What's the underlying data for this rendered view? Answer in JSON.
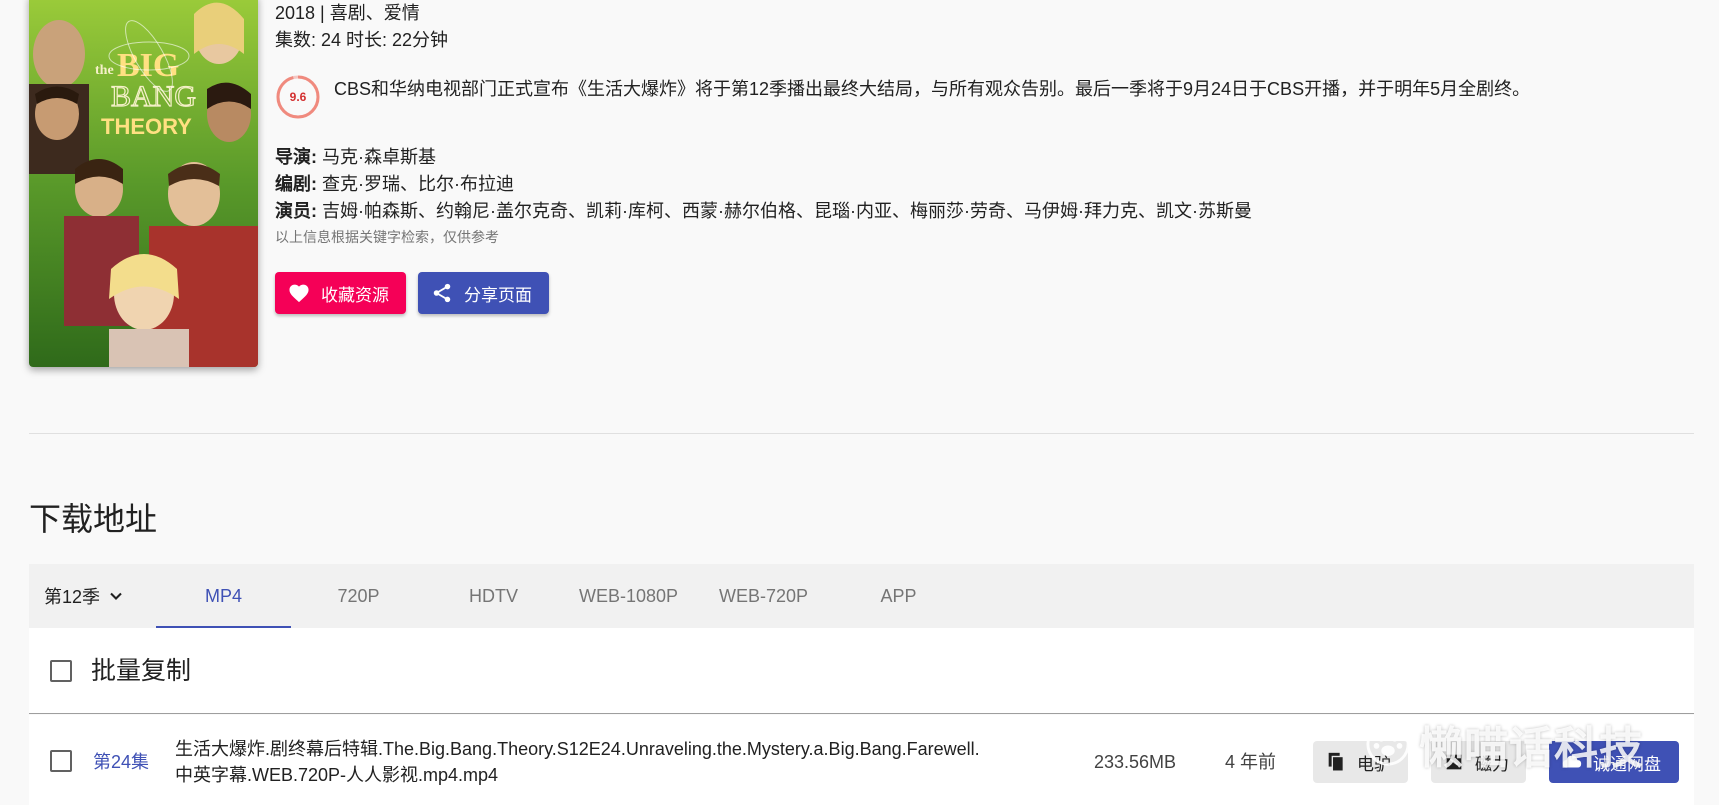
{
  "poster": {
    "title_line1": "the",
    "title_line2": "BIG",
    "title_line3": "BANG",
    "title_line4": "THEORY"
  },
  "info": {
    "year_genre": "2018 | 喜剧、爱情",
    "episodes_duration": "集数: 24 时长: 22分钟",
    "score": "9.6",
    "description": "CBS和华纳电视部门正式宣布《生活大爆炸》将于第12季播出最终大结局，与所有观众告别。最后一季将于9月24日于CBS开播，并于明年5月全剧终。",
    "director_label": "导演:",
    "director": "马克·森卓斯基",
    "writer_label": "编剧:",
    "writer": "查克·罗瑞、比尔·布拉迪",
    "cast_label": "演员:",
    "cast": "吉姆·帕森斯、约翰尼·盖尔克奇、凯莉·库柯、西蒙·赫尔伯格、昆瑙·内亚、梅丽莎·劳奇、马伊姆·拜力克、凯文·苏斯曼",
    "note": "以上信息根据关键字检索，仅供参考"
  },
  "buttons": {
    "favorite": "收藏资源",
    "share": "分享页面"
  },
  "download": {
    "title": "下载地址",
    "season": "第12季",
    "tabs": [
      "MP4",
      "720P",
      "HDTV",
      "WEB-1080P",
      "WEB-720P",
      "APP"
    ],
    "batch_copy": "批量复制",
    "rows": [
      {
        "episode": "第24集",
        "filename_line1": "生活大爆炸.剧终幕后特辑.The.Big.Bang.Theory.S12E24.Unraveling.the.Mystery.a.Big.Bang.Farewell.",
        "filename_line2": "中英字幕.WEB.720P-人人影视.mp4.mp4",
        "size": "233.56MB",
        "age": "4 年前",
        "ed2k": "电驴",
        "magnet": "磁力",
        "pan": "诚通网盘"
      }
    ]
  },
  "watermark": "懒喵话科技",
  "colors": {
    "primary": "#3f51b5",
    "favorite": "#f50057",
    "score": "#d32f2f"
  }
}
